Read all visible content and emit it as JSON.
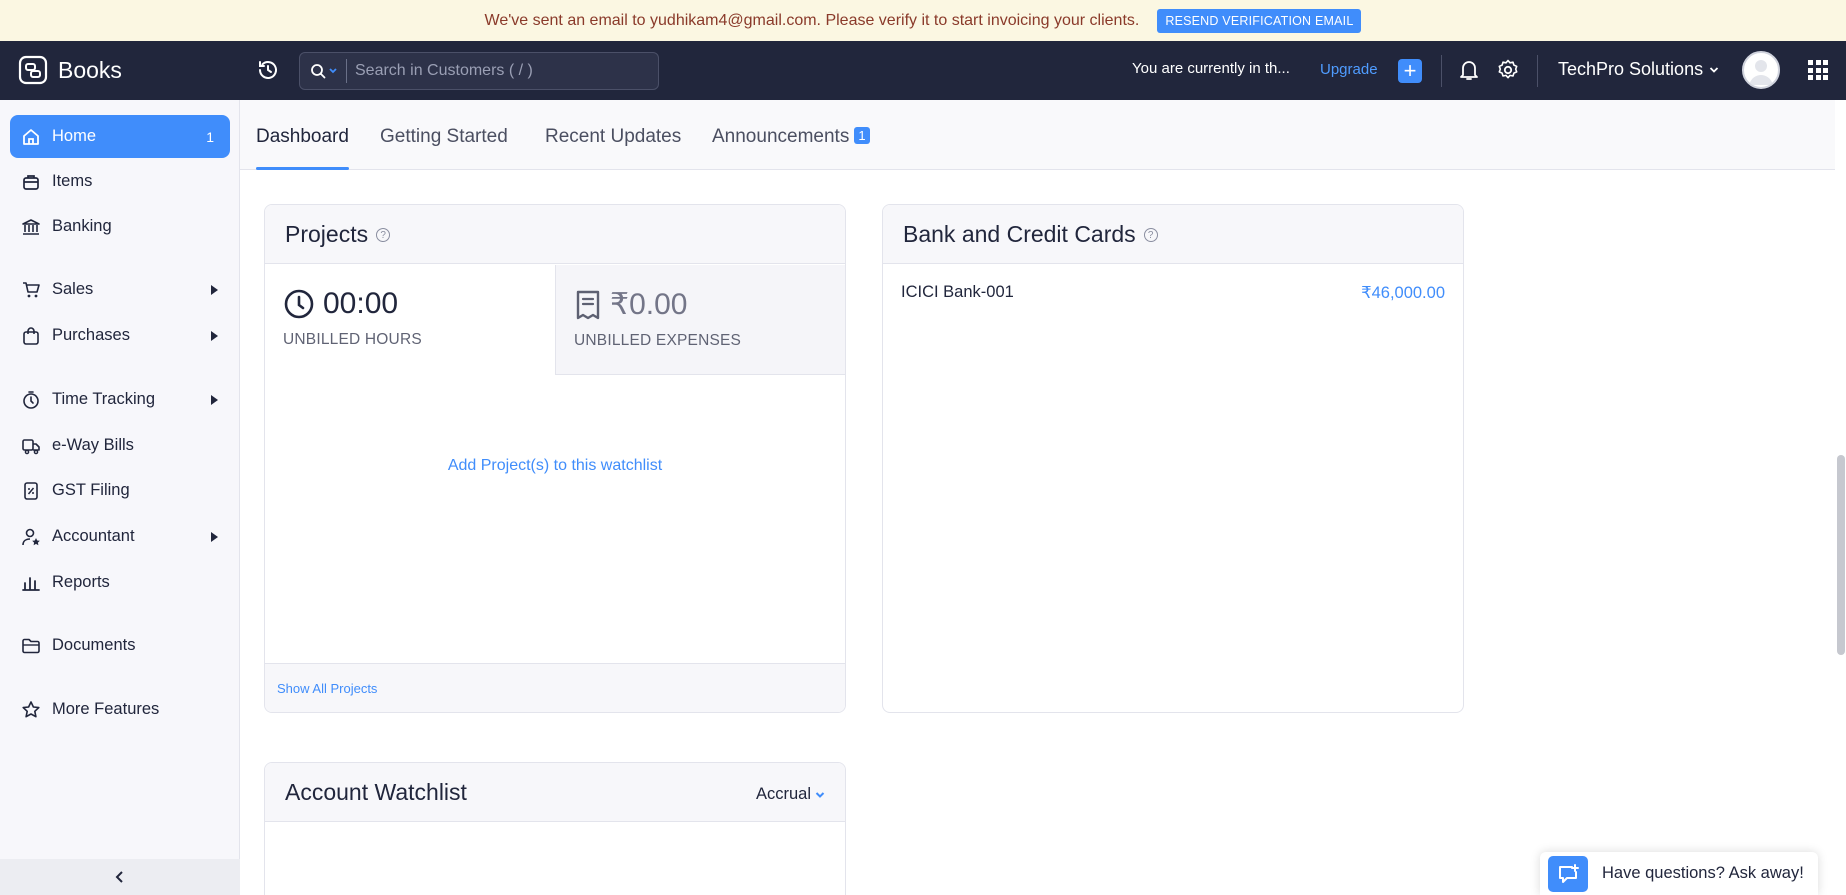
{
  "banner": {
    "message": "We've sent an email to yudhikam4@gmail.com. Please verify it to start invoicing your clients.",
    "resend_label": "RESEND VERIFICATION EMAIL"
  },
  "topbar": {
    "brand": "Books",
    "search_placeholder": "Search in Customers ( / )",
    "trial_text": "You are currently in th...",
    "upgrade_label": "Upgrade",
    "org_name": "TechPro Solutions"
  },
  "sidebar": {
    "items": [
      {
        "label": "Home",
        "badge": "1"
      },
      {
        "label": "Items"
      },
      {
        "label": "Banking"
      },
      {
        "label": "Sales"
      },
      {
        "label": "Purchases"
      },
      {
        "label": "Time Tracking"
      },
      {
        "label": "e-Way Bills"
      },
      {
        "label": "GST Filing"
      },
      {
        "label": "Accountant"
      },
      {
        "label": "Reports"
      },
      {
        "label": "Documents"
      },
      {
        "label": "More Features"
      }
    ]
  },
  "tabs": [
    {
      "label": "Dashboard"
    },
    {
      "label": "Getting Started"
    },
    {
      "label": "Recent Updates"
    },
    {
      "label": "Announcements",
      "badge": "1"
    }
  ],
  "projects": {
    "title": "Projects",
    "unbilled_hours_value": "00:00",
    "unbilled_hours_label": "UNBILLED HOURS",
    "unbilled_expenses_value": "₹0.00",
    "unbilled_expenses_label": "UNBILLED EXPENSES",
    "add_link": "Add Project(s) to this watchlist",
    "footer_link": "Show All Projects"
  },
  "bank": {
    "title": "Bank and Credit Cards",
    "accounts": [
      {
        "name": "ICICI Bank-001",
        "amount": "₹46,000.00"
      }
    ]
  },
  "watchlist": {
    "title": "Account Watchlist",
    "basis": "Accrual"
  },
  "help_widget": {
    "label": "Have questions? Ask away!"
  },
  "colors": {
    "accent": "#408dfb",
    "topbar": "#21263c",
    "banner_bg": "#fbf7e2"
  }
}
